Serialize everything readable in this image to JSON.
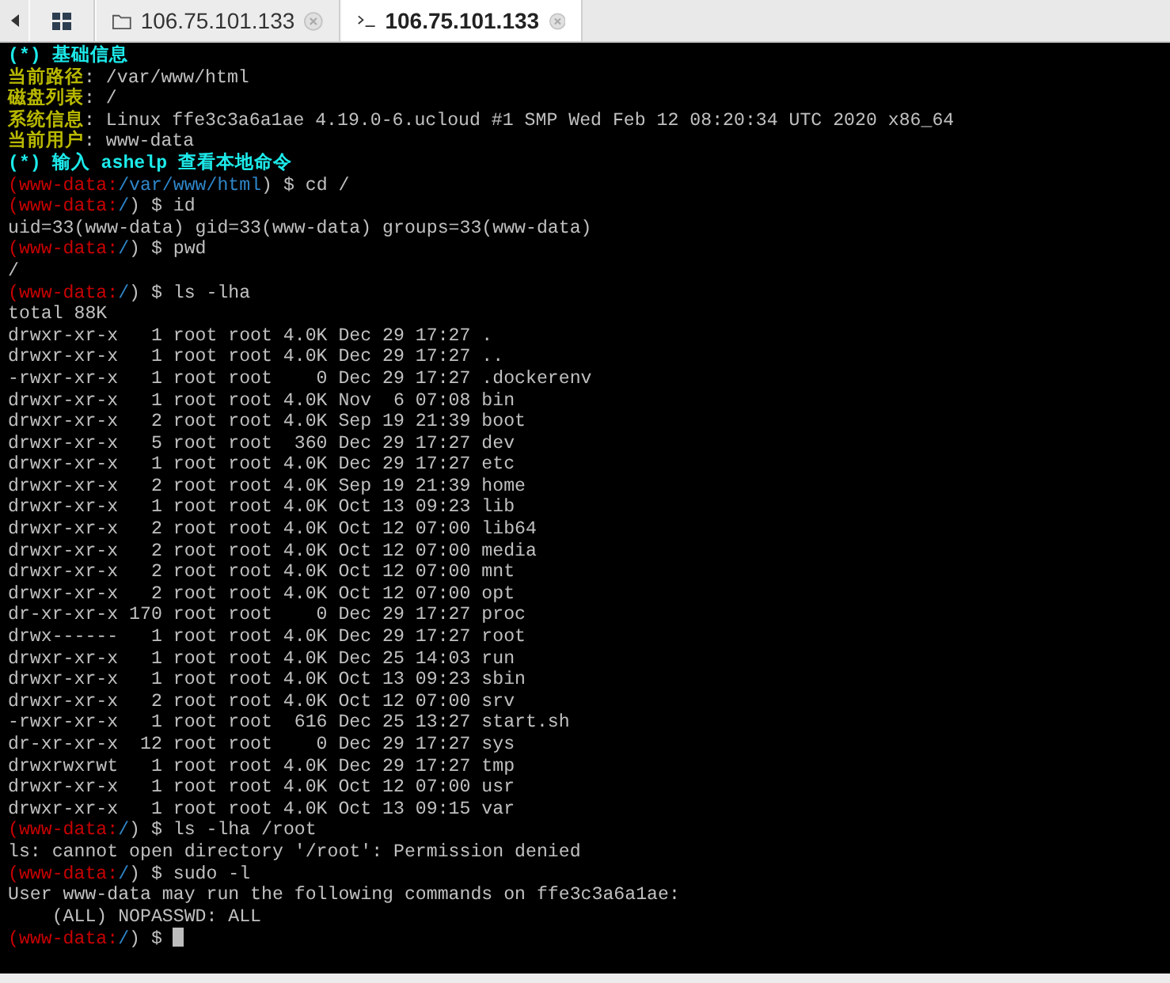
{
  "tabs": [
    {
      "kind": "home",
      "selected": false
    },
    {
      "kind": "folder",
      "label": "106.75.101.133",
      "selected": false
    },
    {
      "kind": "terminal",
      "label": "106.75.101.133",
      "selected": true
    }
  ],
  "terminal": {
    "lines": [
      {
        "kind": "heading",
        "text": "(*) 基础信息"
      },
      {
        "kind": "info",
        "label": "当前路径",
        "value": ": /var/www/html"
      },
      {
        "kind": "info",
        "label": "磁盘列表",
        "value": ": /"
      },
      {
        "kind": "info",
        "label": "系统信息",
        "value": ": Linux ffe3c3a6a1ae 4.19.0-6.ucloud #1 SMP Wed Feb 12 08:20:34 UTC 2020 x86_64"
      },
      {
        "kind": "info",
        "label": "当前用户",
        "value": ": www-data"
      },
      {
        "kind": "heading",
        "text": "(*) 输入 ashelp 查看本地命令"
      },
      {
        "kind": "prompt",
        "user": "(www-data:",
        "path": "/var/www/html",
        "command": ") $ cd /",
        "cursor": false
      },
      {
        "kind": "prompt",
        "user": "(www-data:",
        "path": "/",
        "command": ") $ id",
        "cursor": false
      },
      {
        "kind": "output",
        "text": "uid=33(www-data) gid=33(www-data) groups=33(www-data)"
      },
      {
        "kind": "prompt",
        "user": "(www-data:",
        "path": "/",
        "command": ") $ pwd",
        "cursor": false
      },
      {
        "kind": "output",
        "text": "/"
      },
      {
        "kind": "prompt",
        "user": "(www-data:",
        "path": "/",
        "command": ") $ ls -lha",
        "cursor": false
      },
      {
        "kind": "output",
        "text": "total 88K"
      },
      {
        "kind": "output",
        "text": "drwxr-xr-x   1 root root 4.0K Dec 29 17:27 ."
      },
      {
        "kind": "output",
        "text": "drwxr-xr-x   1 root root 4.0K Dec 29 17:27 .."
      },
      {
        "kind": "output",
        "text": "-rwxr-xr-x   1 root root    0 Dec 29 17:27 .dockerenv"
      },
      {
        "kind": "output",
        "text": "drwxr-xr-x   1 root root 4.0K Nov  6 07:08 bin"
      },
      {
        "kind": "output",
        "text": "drwxr-xr-x   2 root root 4.0K Sep 19 21:39 boot"
      },
      {
        "kind": "output",
        "text": "drwxr-xr-x   5 root root  360 Dec 29 17:27 dev"
      },
      {
        "kind": "output",
        "text": "drwxr-xr-x   1 root root 4.0K Dec 29 17:27 etc"
      },
      {
        "kind": "output",
        "text": "drwxr-xr-x   2 root root 4.0K Sep 19 21:39 home"
      },
      {
        "kind": "output",
        "text": "drwxr-xr-x   1 root root 4.0K Oct 13 09:23 lib"
      },
      {
        "kind": "output",
        "text": "drwxr-xr-x   2 root root 4.0K Oct 12 07:00 lib64"
      },
      {
        "kind": "output",
        "text": "drwxr-xr-x   2 root root 4.0K Oct 12 07:00 media"
      },
      {
        "kind": "output",
        "text": "drwxr-xr-x   2 root root 4.0K Oct 12 07:00 mnt"
      },
      {
        "kind": "output",
        "text": "drwxr-xr-x   2 root root 4.0K Oct 12 07:00 opt"
      },
      {
        "kind": "output",
        "text": "dr-xr-xr-x 170 root root    0 Dec 29 17:27 proc"
      },
      {
        "kind": "output",
        "text": "drwx------   1 root root 4.0K Dec 29 17:27 root"
      },
      {
        "kind": "output",
        "text": "drwxr-xr-x   1 root root 4.0K Dec 25 14:03 run"
      },
      {
        "kind": "output",
        "text": "drwxr-xr-x   1 root root 4.0K Oct 13 09:23 sbin"
      },
      {
        "kind": "output",
        "text": "drwxr-xr-x   2 root root 4.0K Oct 12 07:00 srv"
      },
      {
        "kind": "output",
        "text": "-rwxr-xr-x   1 root root  616 Dec 25 13:27 start.sh"
      },
      {
        "kind": "output",
        "text": "dr-xr-xr-x  12 root root    0 Dec 29 17:27 sys"
      },
      {
        "kind": "output",
        "text": "drwxrwxrwt   1 root root 4.0K Dec 29 17:27 tmp"
      },
      {
        "kind": "output",
        "text": "drwxr-xr-x   1 root root 4.0K Oct 12 07:00 usr"
      },
      {
        "kind": "output",
        "text": "drwxr-xr-x   1 root root 4.0K Oct 13 09:15 var"
      },
      {
        "kind": "prompt",
        "user": "(www-data:",
        "path": "/",
        "command": ") $ ls -lha /root",
        "cursor": false
      },
      {
        "kind": "output",
        "text": "ls: cannot open directory '/root': Permission denied"
      },
      {
        "kind": "prompt",
        "user": "(www-data:",
        "path": "/",
        "command": ") $ sudo -l",
        "cursor": false
      },
      {
        "kind": "output",
        "text": "User www-data may run the following commands on ffe3c3a6a1ae:"
      },
      {
        "kind": "output",
        "text": "    (ALL) NOPASSWD: ALL"
      },
      {
        "kind": "prompt",
        "user": "(www-data:",
        "path": "/",
        "command": ") $ ",
        "cursor": true
      }
    ]
  }
}
